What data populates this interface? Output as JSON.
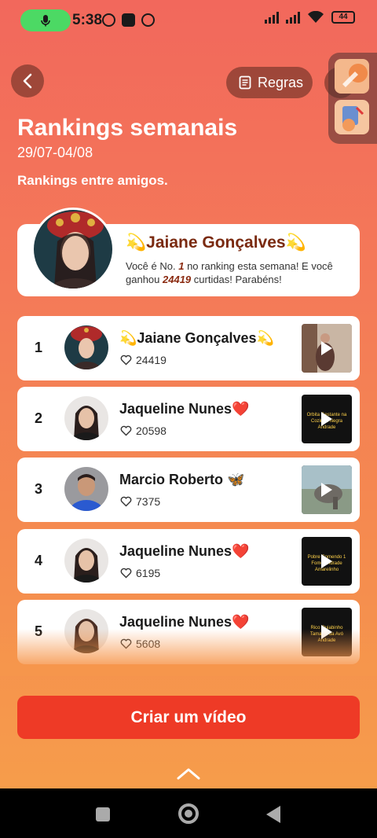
{
  "status_bar": {
    "time": "5:38",
    "battery": "44"
  },
  "header": {
    "rules_label": "Regras",
    "title": "Rankings semanais",
    "date_range": "29/07-04/08",
    "subtitle": "Rankings entre amigos."
  },
  "hero": {
    "name": "💫Jaiane Gonçalves💫",
    "msg_prefix": "Você é No. ",
    "rank": "1",
    "msg_middle": " no ranking esta semana! E você ganhou ",
    "likes": "24419",
    "msg_suffix": " curtidas! Parabéns!"
  },
  "rankings": [
    {
      "rank": "1",
      "name": "💫Jaiane Gonçalves💫",
      "likes": "24419"
    },
    {
      "rank": "2",
      "name": "Jaqueline Nunes❤️",
      "likes": "20598"
    },
    {
      "rank": "3",
      "name": "Marcio Roberto 🦋",
      "likes": "7375"
    },
    {
      "rank": "4",
      "name": "Jaqueline Nunes❤️",
      "likes": "6195"
    },
    {
      "rank": "5",
      "name": "Jaqueline Nunes❤️",
      "likes": "5608"
    }
  ],
  "thumbnail_captions": {
    "row2": "Orbita Gestante na Cozinha Negra Andrade",
    "row4": "Pobre Comendo 1 Fome Andrade Amarelinho",
    "row5": "Rico Quiabinho Tamales da Avó Andrade"
  },
  "create_button": "Criar um vídeo",
  "colors": {
    "accent": "#ee3a26",
    "hero_name": "#7a2a10",
    "mic_pill": "#4cd964"
  }
}
